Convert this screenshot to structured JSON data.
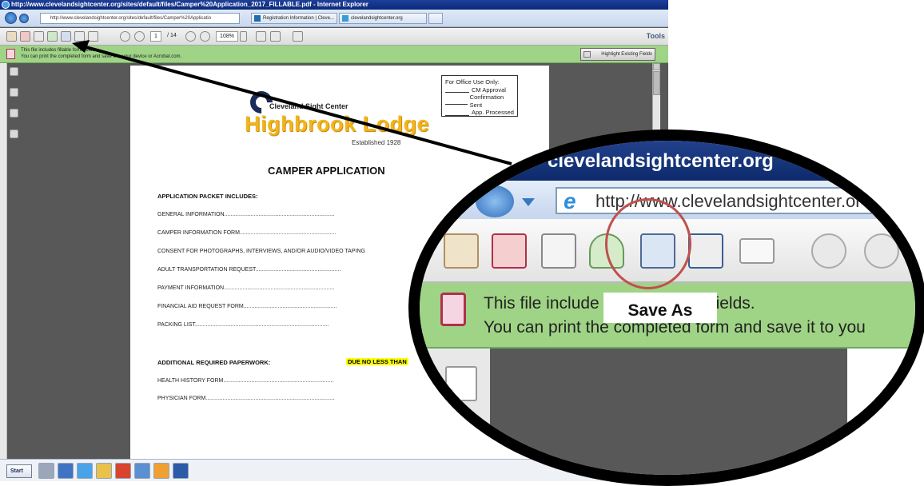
{
  "browser": {
    "title": "http://www.clevelandsightcenter.org/sites/default/files/Camper%20Application_2017_FILLABLE.pdf - Internet Explorer",
    "address": "http://www.clevelandsightcenter.org/sites/default/files/Camper%20Applicatio",
    "tabs": [
      "Registration Information | Cleve...",
      "clevelandsightcenter.org"
    ]
  },
  "pdf_toolbar": {
    "page_current": "1",
    "page_total": "/ 14",
    "zoom": "108%",
    "tools_label": "Tools"
  },
  "notice": {
    "line1": "This file includes fillable form fields.",
    "line2": "You can print the completed form and save it to your device or Acrobat.com.",
    "highlight_button": "Highlight Existing Fields"
  },
  "document": {
    "office": {
      "heading": "For Office Use Only:",
      "items": [
        "CM Approval",
        "Confirmation Sent",
        "App. Processed"
      ]
    },
    "logo_org": "Cleveland Sight Center",
    "logo_name": "Highbrook Lodge",
    "logo_established": "Established 1928",
    "title": "CAMPER APPLICATION",
    "section1": "APPLICATION PACKET INCLUDES:",
    "items1": [
      "GENERAL INFORMATION.......................................................................",
      "CAMPER INFORMATION FORM..............................................................",
      "CONSENT FOR PHOTOGRAPHS, INTERVIEWS, AND/OR AUDIO/VIDEO TAPING",
      "ADULT TRANSPORTATION REQUEST.......................................................",
      "PAYMENT INFORMATION.......................................................................",
      "FINANCIAL AID REQUEST FORM............................................................",
      "PACKING LIST......................................................................................"
    ],
    "section2": "ADDITIONAL REQUIRED PAPERWORK:",
    "due_label": "DUE NO LESS THAN",
    "items2": [
      "HEALTH HISTORY FORM.......................................................................",
      "PHYSICIAN FORM..................................................................................."
    ]
  },
  "taskbar": {
    "start": "Start"
  },
  "magnifier": {
    "title": "clevelandsightcenter.org",
    "address": "http://www.clevelandsightcenter.or",
    "notice_line1_a": "This file include",
    "notice_line1_b": "fields.",
    "notice_line2": "You can print the completed form and save it to you",
    "callout": "Save As"
  },
  "colors": {
    "accent_circle": "#c0504d",
    "notice_green": "#9fd486",
    "logo_gold": "#f1b51f"
  }
}
